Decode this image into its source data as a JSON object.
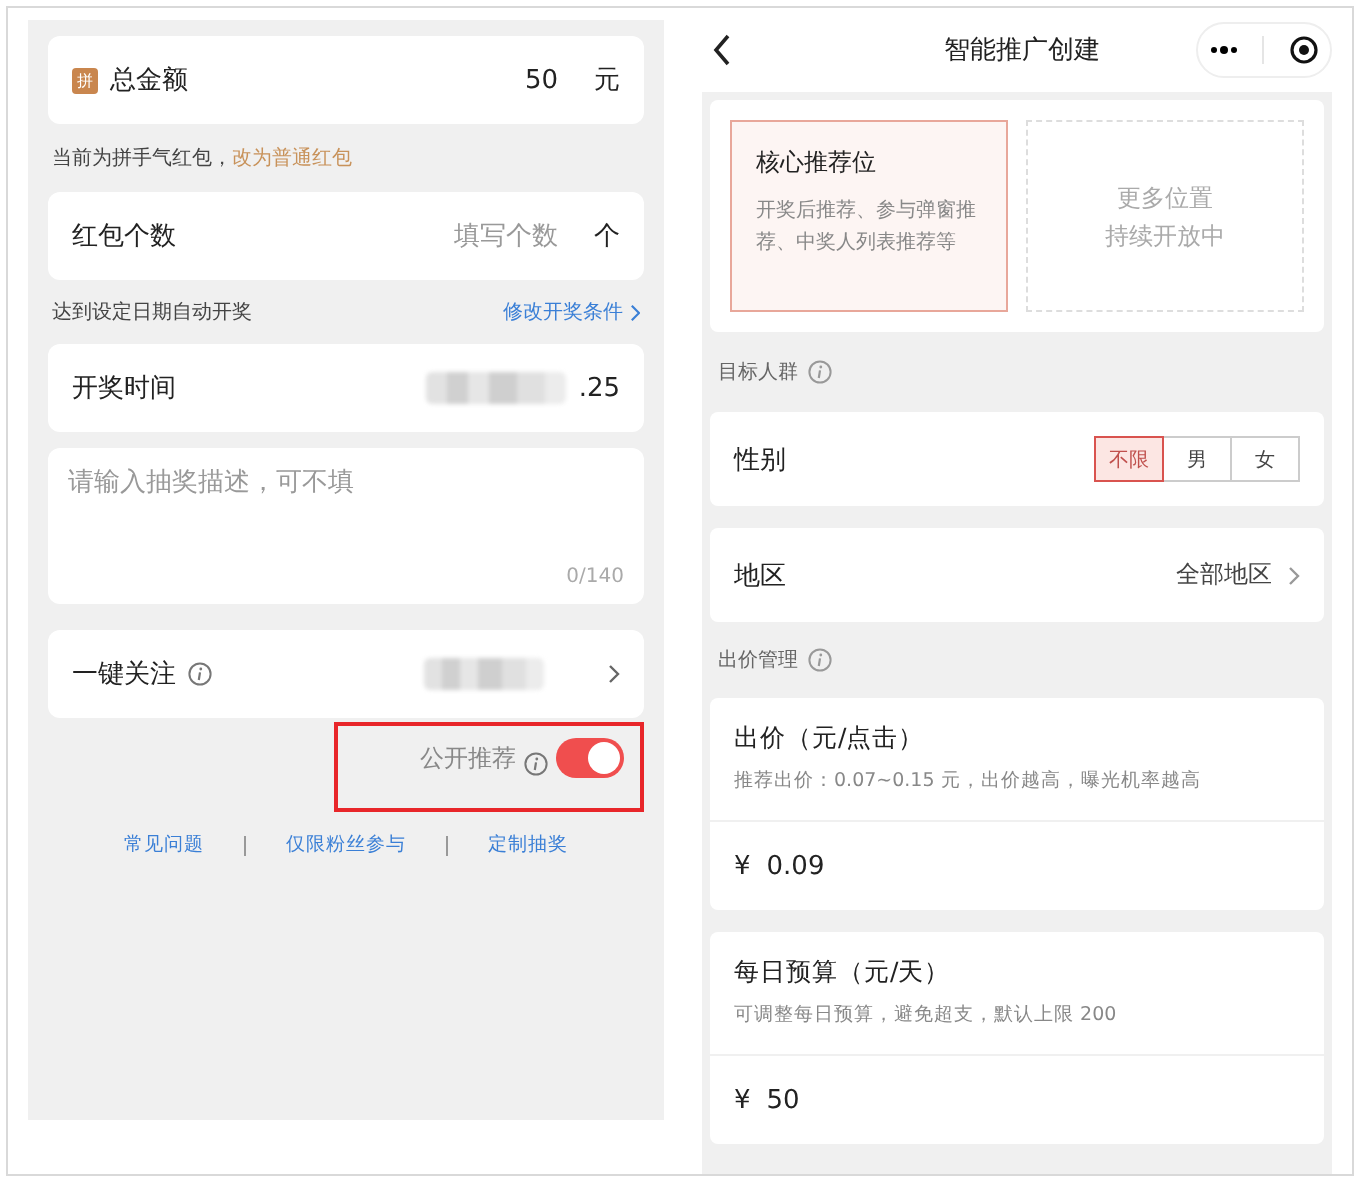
{
  "left_screen": {
    "total_amount": {
      "badge": "拼",
      "label": "总金额",
      "value": "50",
      "unit": "元"
    },
    "amount_note": {
      "text": "当前为拼手气红包，",
      "link": "改为普通红包"
    },
    "count_row": {
      "label": "红包个数",
      "placeholder": "填写个数",
      "unit": "个"
    },
    "draw_note": {
      "text": "达到设定日期自动开奖",
      "link": "修改开奖条件"
    },
    "draw_time_row": {
      "label": "开奖时间",
      "value_tail": ".25"
    },
    "description": {
      "placeholder": "请输入抽奖描述，可不填",
      "counter": "0/140"
    },
    "follow_row": {
      "label": "一键关注"
    },
    "public_recommend": {
      "label": "公开推荐",
      "on": true,
      "highlighted": true
    },
    "footer_links": [
      "常见问题",
      "仅限粉丝参与",
      "定制抽奖"
    ]
  },
  "right_screen": {
    "nav_bar": {
      "title": "智能推广创建"
    },
    "slots": [
      {
        "kind": "option",
        "title": "核心推荐位",
        "description": "开奖后推荐、参与弹窗推荐、中奖人列表推荐等",
        "selected": true
      },
      {
        "kind": "coming_soon",
        "title": "更多位置",
        "description": "持续开放中",
        "selected": false
      }
    ],
    "target_section": "目标人群",
    "gender": {
      "label": "性别",
      "options": [
        {
          "label": "不限",
          "selected": true
        },
        {
          "label": "男",
          "selected": false
        },
        {
          "label": "女",
          "selected": false
        }
      ]
    },
    "region": {
      "label": "地区",
      "value": "全部地区"
    },
    "bid_section": "出价管理",
    "bid": {
      "title": "出价（元/点击）",
      "hint": "推荐出价：0.07~0.15 元，出价越高，曝光机率越高",
      "currency": "¥",
      "value": "0.09"
    },
    "budget": {
      "title": "每日预算（元/天）",
      "hint": "可调整每日预算，避免超支，默认上限 200",
      "currency": "¥",
      "value": "50"
    }
  }
}
